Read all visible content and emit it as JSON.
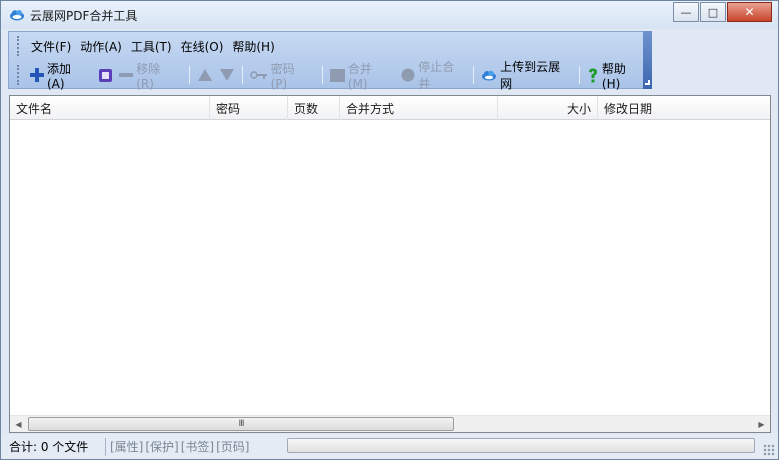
{
  "window": {
    "title": "云展网PDF合并工具",
    "controls": {
      "minimize": "—",
      "maximize": "□",
      "close": "✕"
    }
  },
  "menu": [
    {
      "label": "文件(F)"
    },
    {
      "label": "动作(A)"
    },
    {
      "label": "工具(T)"
    },
    {
      "label": "在线(O)"
    },
    {
      "label": "帮助(H)"
    }
  ],
  "toolbar": {
    "add": {
      "label": "添加 (A)",
      "icon": "plus-icon"
    },
    "clear": {
      "icon": "square-frame-icon"
    },
    "remove": {
      "label": "移除 (R)",
      "icon": "minus-icon"
    },
    "move_up": {
      "icon": "triangle-up-icon"
    },
    "move_down": {
      "icon": "triangle-down-icon"
    },
    "password": {
      "label": "密码 (P)",
      "icon": "key-icon"
    },
    "merge": {
      "label": "合并 (M)",
      "icon": "block-icon"
    },
    "stop": {
      "label": "停止合并",
      "icon": "circle-icon"
    },
    "upload": {
      "label": "上传到云展网",
      "icon": "cloud-icon"
    },
    "help": {
      "label": "帮助 (H)",
      "icon": "question-icon"
    }
  },
  "list": {
    "columns": [
      {
        "label": "文件名"
      },
      {
        "label": "密码"
      },
      {
        "label": "页数"
      },
      {
        "label": "合并方式"
      },
      {
        "label": "大小"
      },
      {
        "label": "修改日期"
      }
    ],
    "rows": []
  },
  "scrollbar": {
    "left": "◀",
    "right": "▶",
    "grip": "III"
  },
  "status": {
    "count": "合计: 0 个文件",
    "tags": [
      "[属性]",
      "[保护]",
      "[书签]",
      "[页码]"
    ],
    "progress": 0
  },
  "colors": {
    "toolbar_bg": "#b9cfee",
    "accent_blue": "#2f6fd0",
    "help_green": "#1e9b2a",
    "close_red": "#c9442a"
  }
}
